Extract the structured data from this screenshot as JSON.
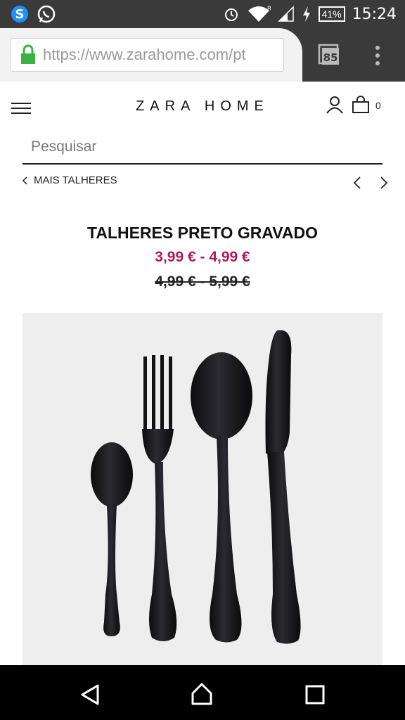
{
  "status_bar": {
    "time": "15:24",
    "battery": "41%",
    "left_icons": [
      "skype-icon",
      "whatsapp-icon"
    ],
    "right_icons": [
      "alarm-icon",
      "wifi-icon",
      "signal-icon",
      "charging-icon"
    ]
  },
  "browser": {
    "url": "https://www.zarahome.com/pt",
    "tab_count": "85"
  },
  "header": {
    "logo": "ZARA HOME",
    "bag_count": "0"
  },
  "search": {
    "placeholder": "Pesquisar"
  },
  "breadcrumb": {
    "label": "MAIS TALHERES"
  },
  "product": {
    "title": "TALHERES PRETO GRAVADO",
    "price_current": "3,99 €  - 4,99 €",
    "price_old": "4,99 €  - 5,99 €"
  },
  "colors": {
    "accent_price": "#b5195e",
    "status_bar_bg": "#3a3a3a"
  }
}
